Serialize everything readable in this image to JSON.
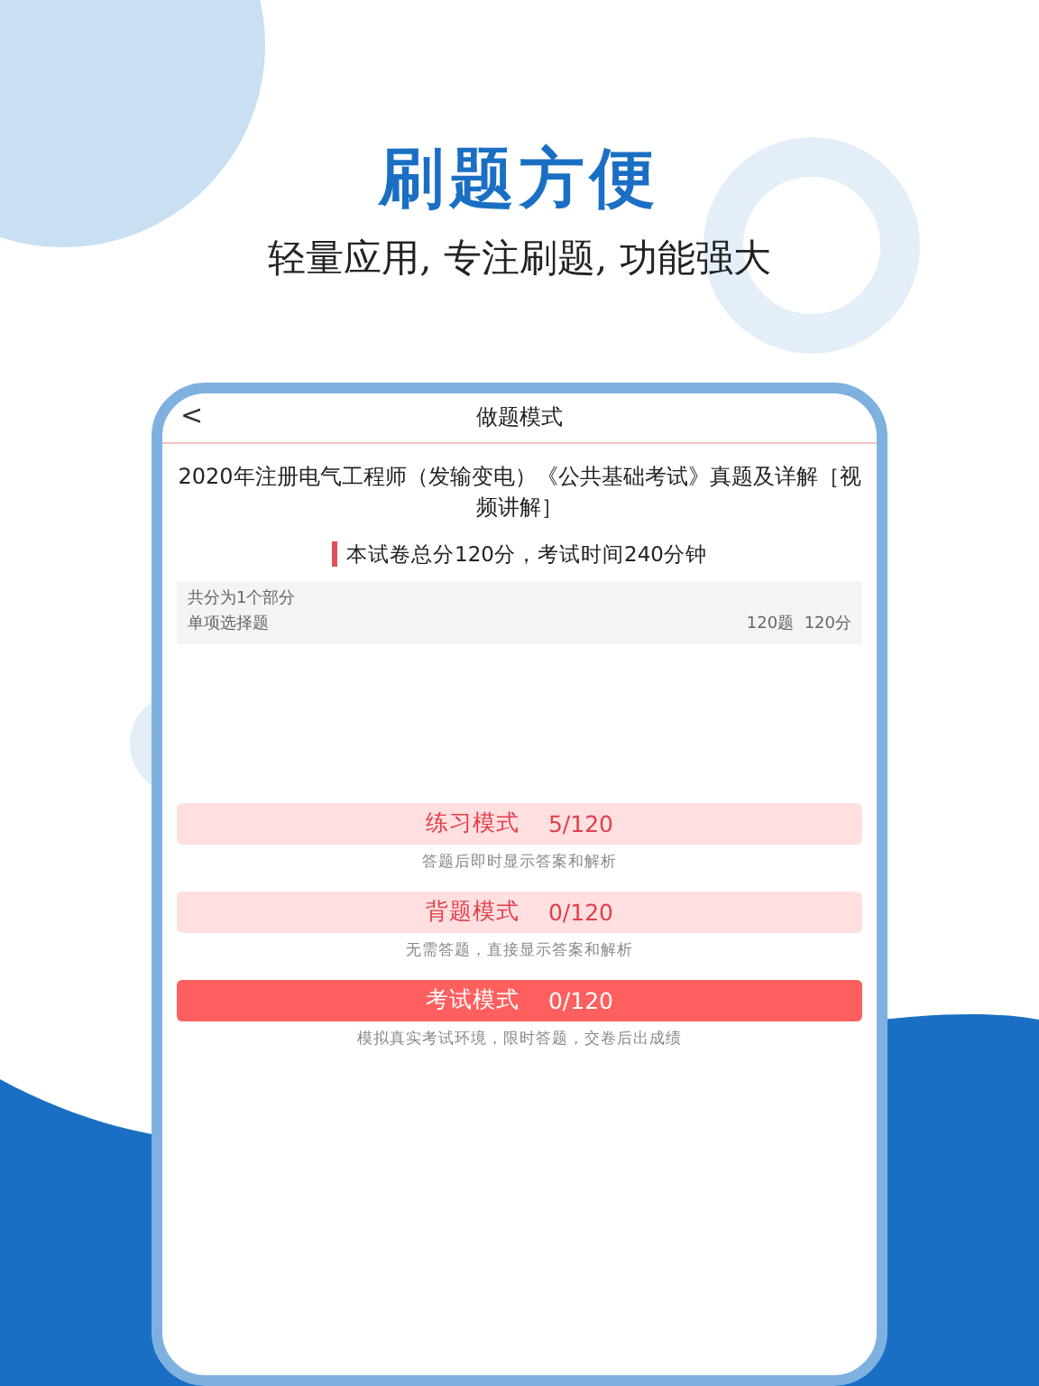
{
  "headline": "刷题方便",
  "tagline": "轻量应用, 专注刷题, 功能强大",
  "screen": {
    "title": "做题模式",
    "back": "<",
    "paper_title": "2020年注册电气工程师（发输变电）《公共基础考试》真题及详解［视频讲解］",
    "summary": "本试卷总分120分，考试时间240分钟",
    "sections_heading": "共分为1个部分",
    "sections": [
      {
        "name": "单项选择题",
        "count": "120题",
        "score": "120分"
      }
    ],
    "modes": [
      {
        "kind": "light",
        "label": "练习模式",
        "progress": "5/120",
        "description": "答题后即时显示答案和解析"
      },
      {
        "kind": "light",
        "label": "背题模式",
        "progress": "0/120",
        "description": "无需答题，直接显示答案和解析"
      },
      {
        "kind": "primary",
        "label": "考试模式",
        "progress": "0/120",
        "description": "模拟真实考试环境，限时答题，交卷后出成绩"
      }
    ]
  }
}
